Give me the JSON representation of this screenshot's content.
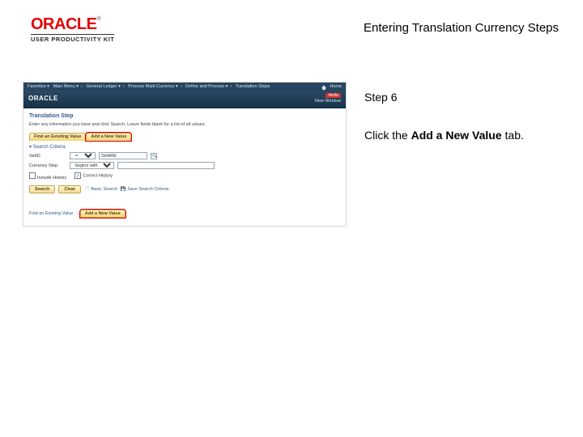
{
  "header": {
    "logo_text": "ORACLE",
    "upk_text": "USER PRODUCTIVITY KIT",
    "title": "Entering Translation Currency Steps"
  },
  "screenshot": {
    "breadcrumb": {
      "items": [
        "Favorites ▾",
        "Main Menu ▾",
        "General Ledger ▾",
        "Process Multi-Currency ▾",
        "Define and Process ▾",
        "Translation Steps"
      ],
      "home": "Home"
    },
    "brand": "ORACLE",
    "hello": "Hello",
    "env_hint": "New Window",
    "page_heading": "Translation Step",
    "description": "Enter any information you have and click Search. Leave fields blank for a list of all values.",
    "tabs": {
      "find": "Find an Existing Value",
      "add": "Add a New Value"
    },
    "search_section": "Search Criteria",
    "fields": {
      "setid_label": "SetID",
      "setid_op": "=",
      "setid_val": "SHARE",
      "step_label": "Currency Step",
      "step_op": "begins with",
      "step_val": ""
    },
    "checks": {
      "include_history": "Include History",
      "correct_history": "Correct History"
    },
    "actions": {
      "search": "Search",
      "clear": "Clear",
      "basic": "Basic Search",
      "save": "Save Search Criteria"
    },
    "bottom": {
      "find_link": "Find an Existing Value",
      "add_tab": "Add a New Value"
    }
  },
  "instructions": {
    "step": "Step 6",
    "line1_a": "Click the ",
    "line1_b": "Add a New Value",
    "line1_c": " tab."
  }
}
